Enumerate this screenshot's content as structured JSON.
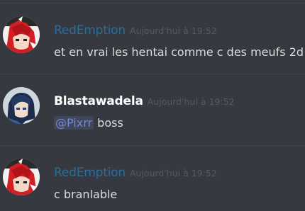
{
  "messages": [
    {
      "username": "RedEmption",
      "timestamp": "Aujourd'hui à 19:52",
      "text": "et en vrai les hentai comme c des meufs 2d",
      "avatar_icon": "anime-red-avatar",
      "username_color": "#2b6d9b"
    },
    {
      "username": "Blastawadela",
      "timestamp": "Aujourd'hui à 19:52",
      "mention": "@Pixrr",
      "text": " boss",
      "avatar_icon": "anime-blue-avatar",
      "username_color": "#ffffff"
    },
    {
      "username": "RedEmption",
      "timestamp": "Aujourd'hui à 19:52",
      "text": "c branlable",
      "avatar_icon": "anime-red-avatar",
      "username_color": "#2b6d9b"
    }
  ]
}
